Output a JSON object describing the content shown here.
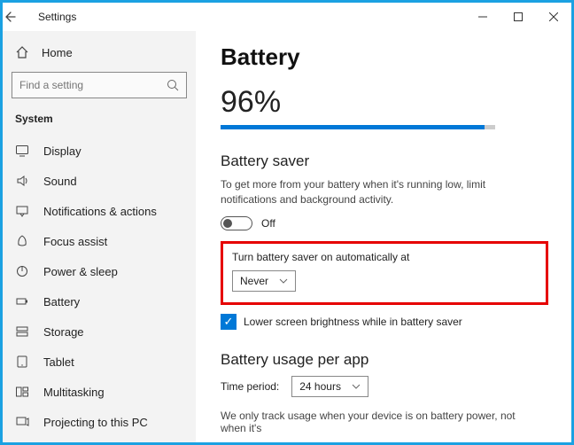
{
  "window": {
    "title": "Settings"
  },
  "sidebar": {
    "home": "Home",
    "search_placeholder": "Find a setting",
    "category": "System",
    "items": [
      {
        "label": "Display",
        "icon": "display-icon"
      },
      {
        "label": "Sound",
        "icon": "sound-icon"
      },
      {
        "label": "Notifications & actions",
        "icon": "notifications-icon"
      },
      {
        "label": "Focus assist",
        "icon": "focus-assist-icon"
      },
      {
        "label": "Power & sleep",
        "icon": "power-icon"
      },
      {
        "label": "Battery",
        "icon": "battery-icon",
        "selected": true
      },
      {
        "label": "Storage",
        "icon": "storage-icon"
      },
      {
        "label": "Tablet",
        "icon": "tablet-icon"
      },
      {
        "label": "Multitasking",
        "icon": "multitasking-icon"
      },
      {
        "label": "Projecting to this PC",
        "icon": "projecting-icon"
      }
    ]
  },
  "main": {
    "title": "Battery",
    "percent": 96,
    "percent_label": "96%",
    "saver_heading": "Battery saver",
    "saver_desc": "To get more from your battery when it's running low, limit notifications and background activity.",
    "saver_toggle_state": "Off",
    "auto_label": "Turn battery saver on automatically at",
    "auto_value": "Never",
    "brightness_check_label": "Lower screen brightness while in battery saver",
    "usage_heading": "Battery usage per app",
    "period_label": "Time period:",
    "period_value": "24 hours",
    "usage_info": "We only track usage when your device is on battery power, not when it's"
  },
  "icons": {
    "display-icon": "<rect x='1.5' y='2.5' width='13' height='9' rx='1' stroke='#444' fill='none'/><line x1='5' y1='14' x2='11' y2='14' stroke='#444'/>",
    "sound-icon": "<path d='M3 6 H6 L10 3 V13 L6 10 H3 Z' stroke='#444' fill='none'/><path d='M12 5 Q14 8 12 11' stroke='#444' fill='none'/>",
    "notifications-icon": "<rect x='2' y='3' width='12' height='8' stroke='#444' fill='none'/><path d='M6 11 L8 14 L10 11' stroke='#444' fill='none'/>",
    "focus-assist-icon": "<path d='M8 2 Q13 5 12 12 Q8 14 4 12 Q3 5 8 2 Z' stroke='#444' fill='none'/>",
    "power-icon": "<circle cx='8' cy='8' r='5.5' stroke='#444' fill='none'/><line x1='8' y1='2' x2='8' y2='8' stroke='#444'/>",
    "battery-icon": "<rect x='2' y='5' width='10' height='6' stroke='#444' fill='none'/><rect x='12.5' y='6.5' width='1.5' height='3' fill='#444'/>",
    "storage-icon": "<rect x='2' y='3' width='12' height='4' stroke='#444' fill='none'/><rect x='2' y='9' width='12' height='4' stroke='#444' fill='none'/>",
    "tablet-icon": "<rect x='3' y='2' width='10' height='12' rx='1' stroke='#444' fill='none'/><circle cx='8' cy='12' r='0.7' fill='#444'/>",
    "multitasking-icon": "<rect x='1.5' y='3' width='5.5' height='10' stroke='#444' fill='none'/><rect x='9' y='3' width='5.5' height='4' stroke='#444' fill='none'/><rect x='9' y='9' width='5.5' height='4' stroke='#444' fill='none'/>",
    "projecting-icon": "<rect x='2' y='3' width='10' height='8' stroke='#444' fill='none'/><path d='M13 5 L15 4 V12 L13 11' stroke='#444' fill='none'/>"
  }
}
